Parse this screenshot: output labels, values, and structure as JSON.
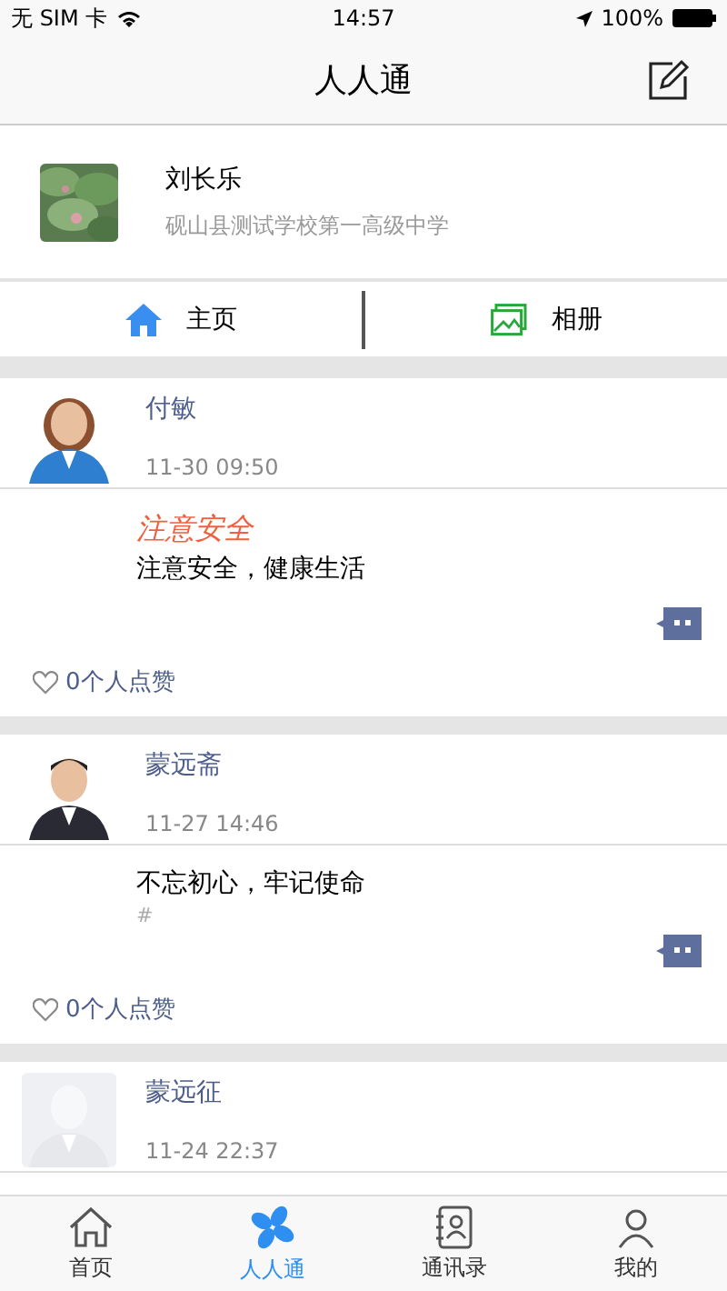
{
  "status_bar": {
    "carrier": "无 SIM 卡",
    "time": "14:57",
    "battery": "100%"
  },
  "nav": {
    "title": "人人通"
  },
  "profile": {
    "name": "刘长乐",
    "school": "砚山县测试学校第一高级中学"
  },
  "profile_tabs": [
    {
      "label": "主页",
      "kind": "home"
    },
    {
      "label": "相册",
      "kind": "album"
    }
  ],
  "posts": [
    {
      "author": "付敏",
      "time": "11-30 09:50",
      "title": "注意安全",
      "body": "注意安全，健康生活",
      "likes": "0个人点赞"
    },
    {
      "author": "蒙远斋",
      "time": "11-27 14:46",
      "body": "不忘初心，牢记使命",
      "tag": "#",
      "likes": "0个人点赞"
    },
    {
      "author": "蒙远征",
      "time": "11-24 22:37"
    }
  ],
  "tab_bar": [
    {
      "label": "首页",
      "kind": "home",
      "selected": false
    },
    {
      "label": "人人通",
      "kind": "fan",
      "selected": true
    },
    {
      "label": "通讯录",
      "kind": "contacts",
      "selected": false
    },
    {
      "label": "我的",
      "kind": "me",
      "selected": false
    }
  ]
}
